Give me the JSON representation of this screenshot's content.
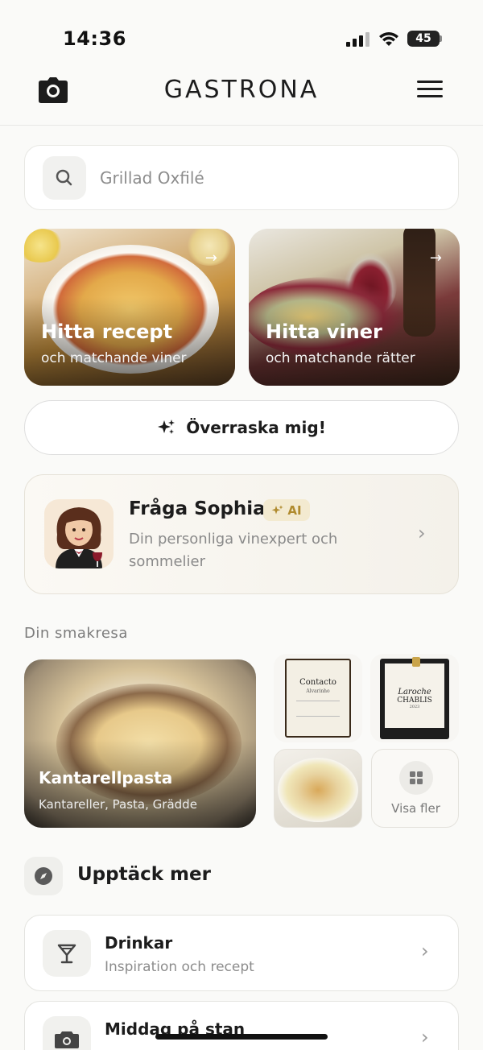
{
  "status": {
    "time": "14:36",
    "battery": "45",
    "battery_level": 0.45
  },
  "header": {
    "logo": "GASTRONA",
    "camera_icon": "camera-icon",
    "menu_icon": "hamburger-menu-icon"
  },
  "search": {
    "placeholder": "Grillad Oxfilé",
    "icon": "search-icon"
  },
  "hero_cards": [
    {
      "title": "Hitta recept",
      "subtitle": "och matchande viner",
      "icon": "arrow-right-icon"
    },
    {
      "title": "Hitta viner",
      "subtitle": "och matchande rätter",
      "icon": "arrow-right-icon"
    }
  ],
  "surprise_button": {
    "label": "Överraska mig!",
    "icon": "sparkles-icon"
  },
  "sophia": {
    "title": "Fråga Sophia",
    "badge": "AI",
    "description": "Din personliga vinexpert och sommelier",
    "icon": "chevron-right-icon"
  },
  "taste_journey": {
    "label": "Din smakresa",
    "featured": {
      "title": "Kantarellpasta",
      "subtitle": "Kantareller, Pasta, Grädde"
    },
    "wine_labels": [
      {
        "name": "Contacto",
        "sub": "Alvarinho"
      },
      {
        "brand": "Laroche",
        "name": "CHABLIS",
        "year": "2023"
      }
    ],
    "more_label": "Visa fler",
    "more_icon": "grid-icon"
  },
  "discover": {
    "title": "Upptäck mer",
    "icon": "compass-icon",
    "items": [
      {
        "title": "Drinkar",
        "subtitle": "Inspiration och recept",
        "icon": "cocktail-glass-icon"
      },
      {
        "title": "Middag på stan",
        "subtitle": "",
        "icon": "camera-icon"
      }
    ]
  },
  "colors": {
    "background": "#fafaf8",
    "accent_gold": "#b08b2e",
    "badge_bg": "#f3ead0",
    "text_primary": "#1c1c1c",
    "text_secondary": "#8c8c8c"
  }
}
